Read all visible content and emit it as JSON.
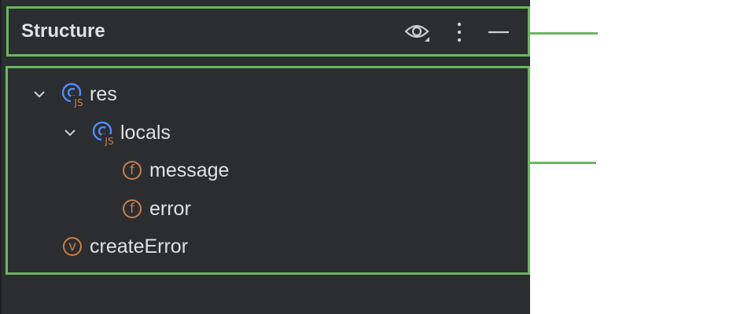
{
  "structure_panel": {
    "title": "Structure",
    "header_buttons": [
      {
        "name": "show-options",
        "icon": "eye-icon"
      },
      {
        "name": "more-options",
        "icon": "vertical-ellipsis-icon"
      },
      {
        "name": "hide",
        "icon": "minimize-icon"
      }
    ],
    "tree": [
      {
        "label": "res",
        "icon": "js-class-icon",
        "expanded": true,
        "depth": 0
      },
      {
        "label": "locals",
        "icon": "js-class-icon",
        "expanded": true,
        "depth": 1
      },
      {
        "label": "message",
        "icon": "field-icon",
        "icon_glyph": "f",
        "depth": 2
      },
      {
        "label": "error",
        "icon": "field-icon",
        "icon_glyph": "f",
        "depth": 2
      },
      {
        "label": "createError",
        "icon": "variable-icon",
        "icon_glyph": "v",
        "depth": 0
      }
    ]
  },
  "colors": {
    "panel_bg": "#2b2d30",
    "text": "#dfe1e5",
    "highlight_border": "#6ab75e",
    "class_icon": "#548af7",
    "js_badge": "#c7804c",
    "field_icon": "#c7804c"
  }
}
